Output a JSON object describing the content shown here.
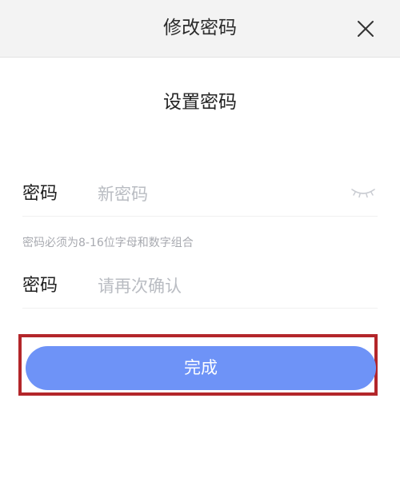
{
  "header": {
    "title": "修改密码",
    "close_icon": "close-icon"
  },
  "form": {
    "section_title": "设置密码",
    "new_password": {
      "label": "密码",
      "placeholder": "新密码",
      "visibility_icon": "eye-closed-icon"
    },
    "hint": "密码必须为8-16位字母和数字组合",
    "confirm_password": {
      "label": "密码",
      "placeholder": "请再次确认"
    },
    "submit_label": "完成"
  },
  "colors": {
    "header_bg": "#f3f3f3",
    "primary_button": "#6e93f7",
    "highlight_border": "#b3262a",
    "placeholder": "#b9bcc2",
    "hint_text": "#a8aab0"
  }
}
